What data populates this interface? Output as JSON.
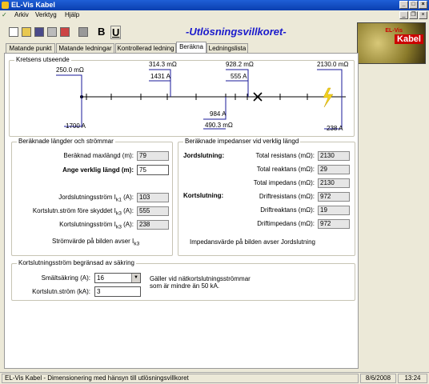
{
  "window": {
    "title": "EL-Vis Kabel"
  },
  "menu": [
    "Arkiv",
    "Verktyg",
    "Hjälp"
  ],
  "toolbar": {
    "bold": "B",
    "underline": "U"
  },
  "app_title": "-Utlösningsvillkoret-",
  "logo": {
    "brand": "EL-Vis",
    "text": "Kabel"
  },
  "tabs": [
    "Matande punkt",
    "Matande ledningar",
    "Kontrollerad ledning",
    "Beräkna",
    "Ledningslista"
  ],
  "circuit": {
    "title": "Kretsens utseende",
    "labels": {
      "a": "250.0 mΩ",
      "b": "314.3 mΩ",
      "c": "1431 A",
      "d": "928.2 mΩ",
      "e": "555 A",
      "f": "2130.0 mΩ",
      "g": "1700 A",
      "h": "984 A",
      "i": "490.3 mΩ",
      "j": "238 A"
    }
  },
  "lengths": {
    "title": "Beräknade längder och strömmar",
    "max_label": "Beräknad maxlängd (m):",
    "max_value": "79",
    "actual_label": "Ange verklig längd (m):",
    "actual_value": "75",
    "jord_label": "Jordslutningsström I",
    "jord_sub": "k1",
    "jord_unit": " (A):",
    "jord_value": "103",
    "fore_label": "Kortslutn.ström före skyddet I",
    "fore_sub": "k3",
    "fore_unit": " (A):",
    "fore_value": "555",
    "kort_label": "Kortslutningsström I",
    "kort_sub": "k3",
    "kort_unit": " (A):",
    "kort_value": "238",
    "note": "Strömvärde på bilden avser I",
    "note_sub": "k3"
  },
  "impedances": {
    "title": "Beräknade impedanser vid verklig längd",
    "jord_heading": "Jordslutning:",
    "kort_heading": "Kortslutning:",
    "rows": [
      {
        "label": "Total resistans (mΩ):",
        "value": "2130"
      },
      {
        "label": "Total reaktans (mΩ):",
        "value": "29"
      },
      {
        "label": "Total impedans (mΩ):",
        "value": "2130"
      },
      {
        "label": "Driftresistans (mΩ):",
        "value": "972"
      },
      {
        "label": "Driftreaktans (mΩ):",
        "value": "19"
      },
      {
        "label": "Driftimpedans (mΩ):",
        "value": "972"
      }
    ],
    "note": "Impedansvärde på bilden avser Jordslutning"
  },
  "limit": {
    "title": "Kortslutningsström begränsad av säkring",
    "fuse_label": "Smältsäkring (A):",
    "fuse_value": "16",
    "current_label": "Kortslutn.ström (kA):",
    "current_value": "3",
    "info": "Gäller vid nätkortslutningsströmmar som är mindre än 50 kA."
  },
  "status": {
    "text": "EL-Vis Kabel - Dimensionering med hänsyn till utlösningsvillkoret",
    "date": "8/6/2008",
    "time": "13:24"
  }
}
